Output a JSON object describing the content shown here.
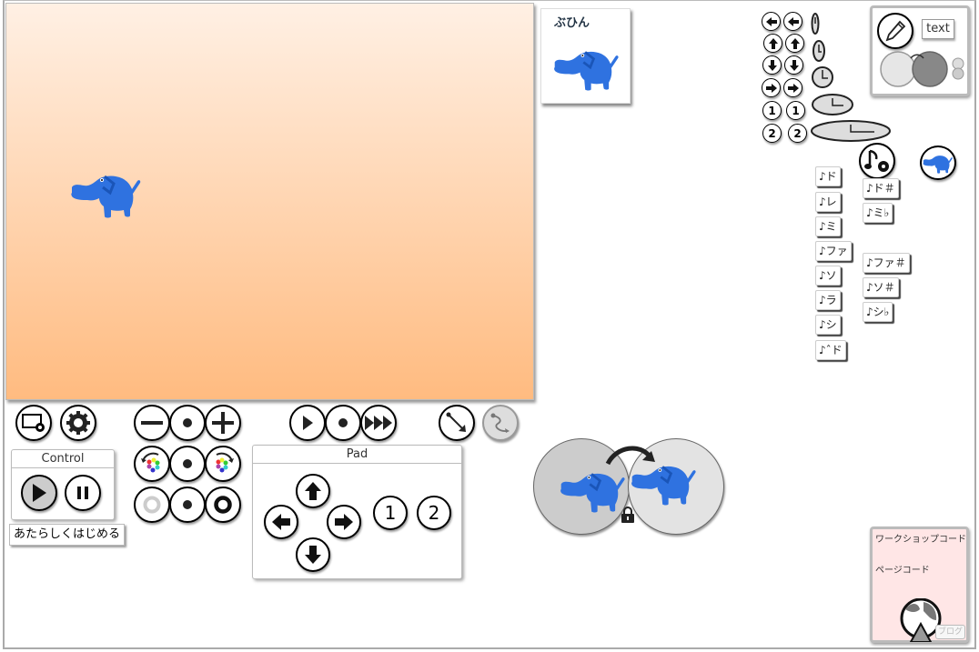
{
  "parts_panel": {
    "title": "ぶひん",
    "items": [
      {
        "icon": "elephant-sprite"
      }
    ]
  },
  "stage": {
    "sprite": "elephant-sprite",
    "background_top": "#fff0e4",
    "background_bottom": "#ffbb80"
  },
  "toolbar": {
    "screen_settings_icon": "screen-gear-icon",
    "settings_icon": "gear-icon",
    "zoom_out": "minus-icon",
    "zoom_reset": "dot-icon",
    "zoom_in": "plus-icon",
    "rotate_left": "rotate-left-colors-icon",
    "rotate_reset": "dot-icon",
    "rotate_right": "rotate-right-colors-icon",
    "thin": "ring-light-icon",
    "ring_reset": "dot-icon",
    "thick": "ring-bold-icon",
    "speed_slow": "play-icon",
    "speed_stop": "dot-icon",
    "speed_fast": "fast-forward-icon",
    "straight_move": "straight-arrow-icon",
    "curve_move": "curve-arrow-icon"
  },
  "control_panel": {
    "title": "Control",
    "play": "play-icon",
    "pause": "pause-icon"
  },
  "restart_label": "あたらしくはじめる",
  "pad_panel": {
    "title": "Pad",
    "buttons": [
      "up",
      "left",
      "right",
      "down"
    ],
    "num1": "1",
    "num2": "2"
  },
  "keys": {
    "rows": [
      {
        "icon": "arrow-left-icon"
      },
      {
        "icon": "arrow-up-icon"
      },
      {
        "icon": "arrow-down-icon"
      },
      {
        "icon": "arrow-right-icon"
      },
      {
        "label": "1"
      },
      {
        "label": "2"
      }
    ],
    "timers": [
      "timer-1",
      "timer-2",
      "timer-3",
      "timer-4",
      "timer-5"
    ]
  },
  "pen_panel": {
    "text_label": "text",
    "pen_icon": "pencil-icon"
  },
  "sound": {
    "settings_icon": "note-gear-icon",
    "notes_natural": [
      "♪ド",
      "♪レ",
      "♪ミ",
      "♪ファ",
      "♪ソ",
      "♪ラ",
      "♪シ",
      "♪ˆド"
    ],
    "notes_accidental": [
      "♪ド＃",
      "♪ミ♭",
      "♪ファ＃",
      "♪ソ＃",
      "♪シ♭"
    ]
  },
  "transform": {
    "lock_icon": "lock-icon",
    "arrow_icon": "curved-arrow-icon"
  },
  "workshop": {
    "workshop_code_label": "ワークショップコード",
    "page_code_label": "ページコード",
    "blog_label": "ブログ"
  }
}
